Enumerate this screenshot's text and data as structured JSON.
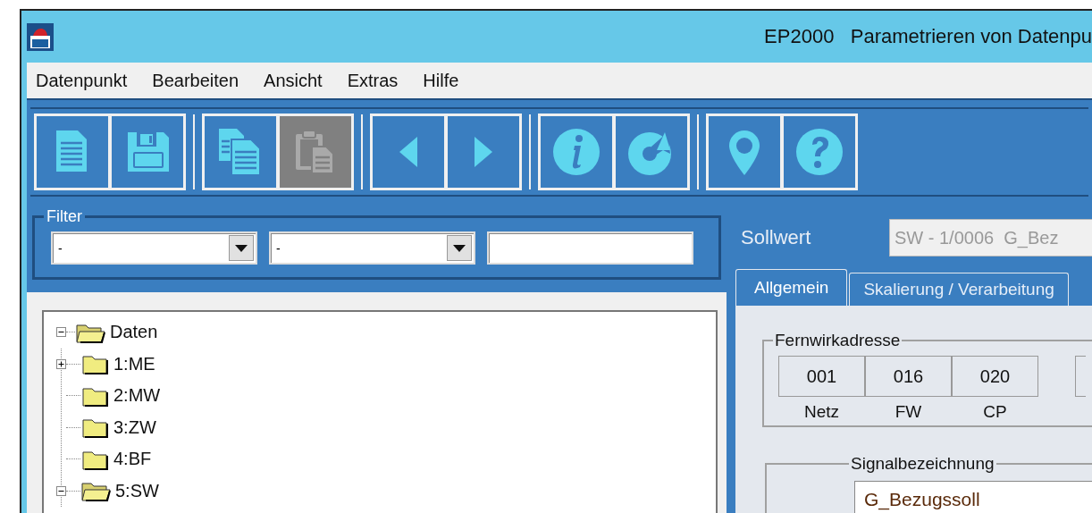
{
  "window": {
    "title": "EP2000   Parametrieren von Datenpu"
  },
  "menu": [
    "Datenpunkt",
    "Bearbeiten",
    "Ansicht",
    "Extras",
    "Hilfe"
  ],
  "toolbar": [
    {
      "buttons": [
        {
          "kind": "document",
          "disabled": false
        },
        {
          "kind": "save",
          "disabled": false
        }
      ]
    },
    {
      "buttons": [
        {
          "kind": "copy",
          "disabled": false
        },
        {
          "kind": "paste",
          "disabled": true
        }
      ]
    },
    {
      "buttons": [
        {
          "kind": "back",
          "disabled": false
        },
        {
          "kind": "forward",
          "disabled": false
        }
      ]
    },
    {
      "buttons": [
        {
          "kind": "info",
          "disabled": false
        },
        {
          "kind": "refresh",
          "disabled": false
        }
      ]
    },
    {
      "buttons": [
        {
          "kind": "pin",
          "disabled": false
        },
        {
          "kind": "help",
          "disabled": false
        }
      ]
    }
  ],
  "filter": {
    "title": "Filter",
    "dropdowns": [
      {
        "value": "-"
      },
      {
        "value": "-"
      }
    ]
  },
  "tree": [
    {
      "label": "Daten",
      "kind": "branch",
      "expanded": true,
      "children": [
        {
          "label": "1:ME",
          "kind": "branch",
          "expanded": false
        },
        {
          "label": "2:MW",
          "kind": "leaf"
        },
        {
          "label": "3:ZW",
          "kind": "leaf"
        },
        {
          "label": "4:BF",
          "kind": "leaf"
        },
        {
          "label": "5:SW",
          "kind": "branch",
          "expanded": true
        }
      ]
    }
  ],
  "detail": {
    "label": "Sollwert",
    "value": "SW - 1/0006  G_Bez",
    "disabled": true,
    "tabs": [
      {
        "label": "Allgemein",
        "selected": true
      },
      {
        "label": "Skalierung / Verarbeitung",
        "selected": false
      }
    ],
    "address": {
      "title": "Fernwirkadresse",
      "fields": [
        {
          "value": "001",
          "label": "Netz"
        },
        {
          "value": "016",
          "label": "FW"
        },
        {
          "value": "020",
          "label": "CP"
        }
      ]
    },
    "signal": {
      "title": "Signalbezeichnung",
      "value": "G_Bezugssoll"
    }
  }
}
